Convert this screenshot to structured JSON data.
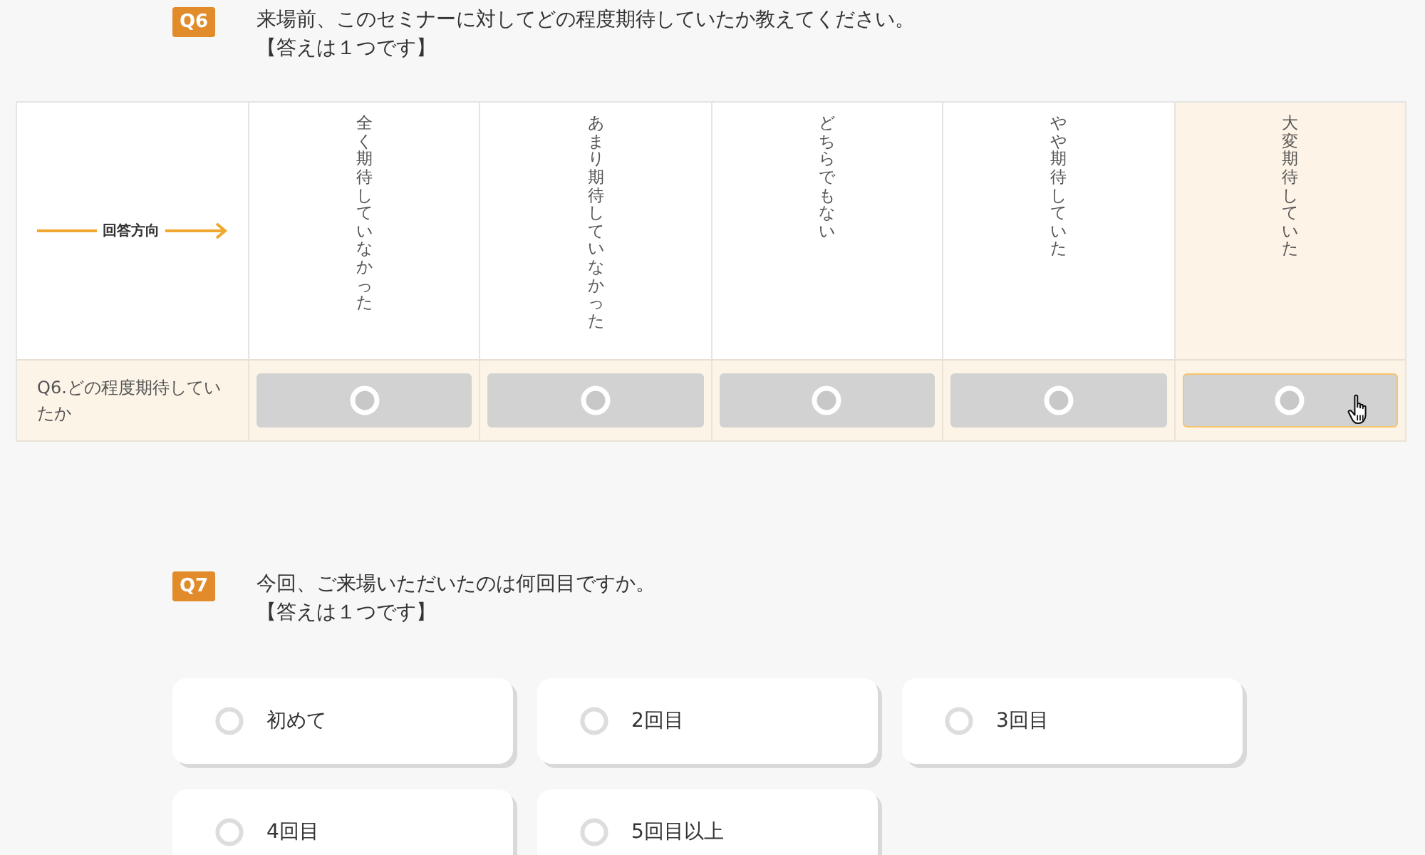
{
  "questions": [
    {
      "kind": "matrix",
      "badge": "Q6",
      "text": "来場前、このセミナーに対してどの程度期待していたか教えてください。",
      "note": "【答えは１つです】",
      "direction_label": "回答方向",
      "columns": [
        {
          "label": "全く期待していなかった",
          "hovered": false
        },
        {
          "label": "あまり期待していなかった",
          "hovered": false
        },
        {
          "label": "どちらでもない",
          "hovered": false
        },
        {
          "label": "やや期待していた",
          "hovered": false
        },
        {
          "label": "大変期待していた",
          "hovered": true
        }
      ],
      "rows": [
        {
          "label": "Q6.どの程度期待していたか",
          "choices": [
            {
              "selected": false
            },
            {
              "selected": false
            },
            {
              "selected": false
            },
            {
              "selected": false
            },
            {
              "selected": false
            }
          ]
        }
      ]
    },
    {
      "kind": "choice",
      "badge": "Q7",
      "text": "今回、ご来場いただいたのは何回目ですか。",
      "note": "【答えは１つです】",
      "options": [
        {
          "label": "初めて",
          "selected": false
        },
        {
          "label": "2回目",
          "selected": false
        },
        {
          "label": "3回目",
          "selected": false
        },
        {
          "label": "4回目",
          "selected": false
        },
        {
          "label": "5回目以上",
          "selected": false
        }
      ]
    }
  ]
}
